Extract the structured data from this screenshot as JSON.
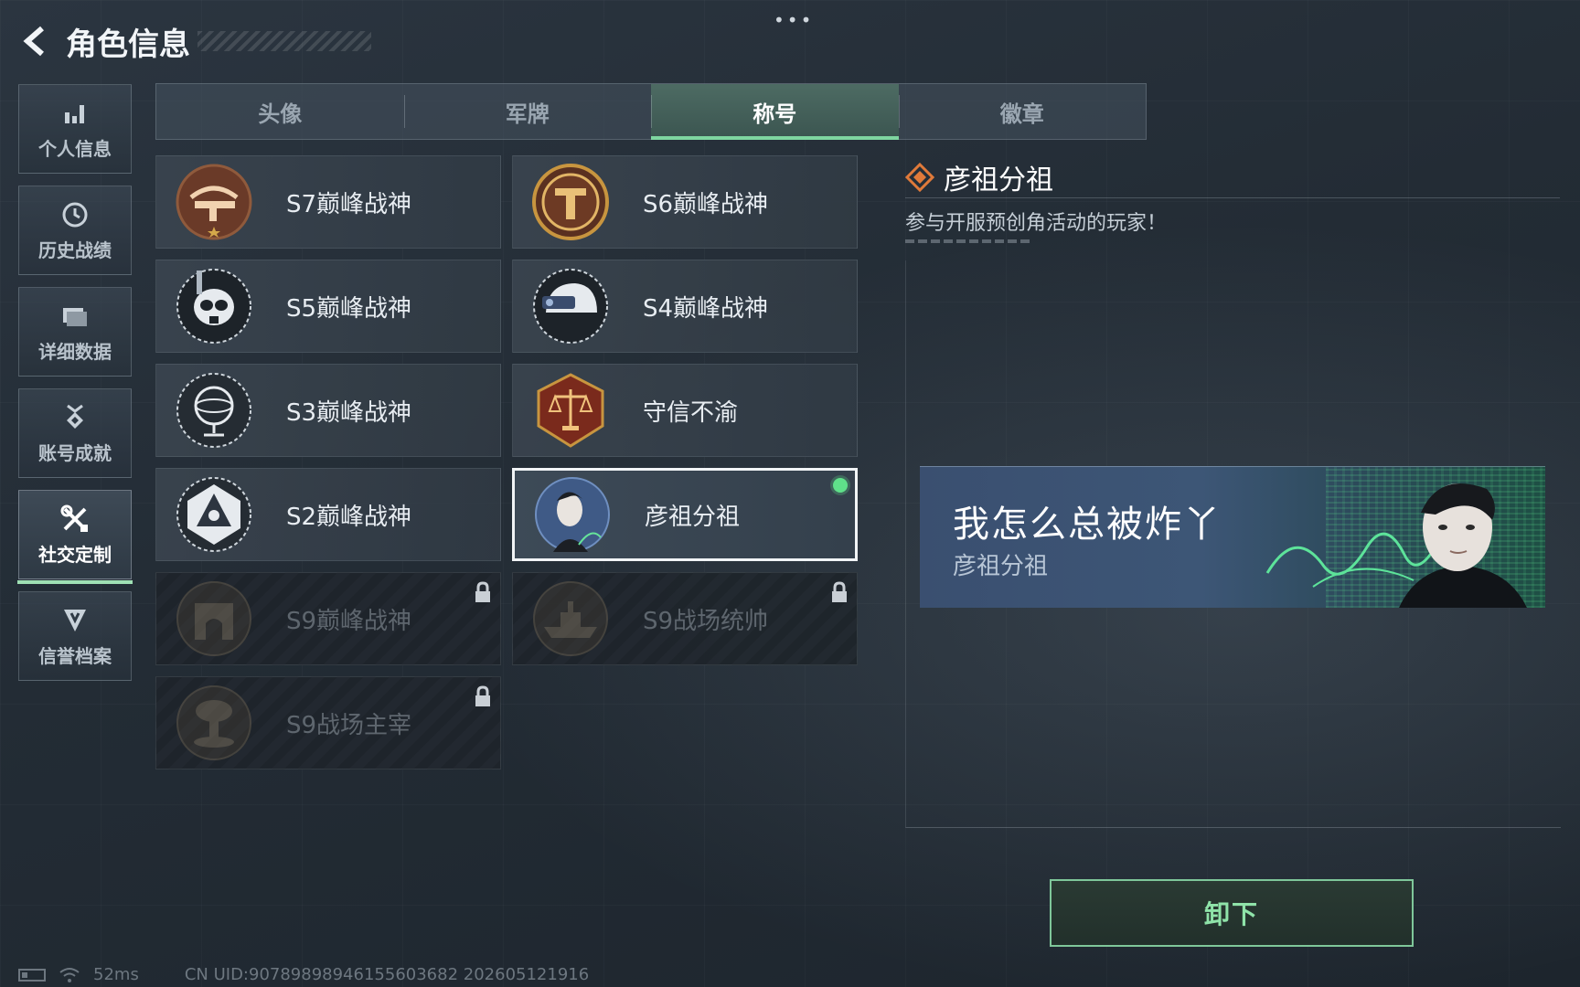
{
  "header": {
    "title": "角色信息",
    "menu_dots": "•••"
  },
  "sidebar": {
    "items": [
      {
        "label": "个人信息",
        "icon": "bar-chart-icon",
        "active": false
      },
      {
        "label": "历史战绩",
        "icon": "clock-icon",
        "active": false
      },
      {
        "label": "详细数据",
        "icon": "folder-icon",
        "active": false
      },
      {
        "label": "账号成就",
        "icon": "medal-icon",
        "active": false
      },
      {
        "label": "社交定制",
        "icon": "tools-icon",
        "active": true
      },
      {
        "label": "信誉档案",
        "icon": "shield-badge-icon",
        "active": false
      }
    ]
  },
  "tabs": [
    {
      "label": "头像",
      "active": false
    },
    {
      "label": "军牌",
      "active": false
    },
    {
      "label": "称号",
      "active": true
    },
    {
      "label": "徽章",
      "active": false
    }
  ],
  "titles": [
    {
      "label": "S7巅峰战神",
      "icon": "crossbow-emblem-icon",
      "state": "unlocked"
    },
    {
      "label": "S6巅峰战神",
      "icon": "t-shield-emblem-icon",
      "state": "unlocked"
    },
    {
      "label": "S5巅峰战神",
      "icon": "skull-diver-emblem-icon",
      "state": "unlocked"
    },
    {
      "label": "S4巅峰战神",
      "icon": "helmet-emblem-icon",
      "state": "unlocked"
    },
    {
      "label": "S3巅峰战神",
      "icon": "globe-emblem-icon",
      "state": "unlocked"
    },
    {
      "label": "守信不渝",
      "icon": "scales-emblem-icon",
      "state": "unlocked"
    },
    {
      "label": "S2巅峰战神",
      "icon": "triangle-emblem-icon",
      "state": "unlocked"
    },
    {
      "label": "彦祖分祖",
      "icon": "portrait-emblem-icon",
      "state": "equipped"
    },
    {
      "label": "S9巅峰战神",
      "icon": "building-emblem-icon",
      "state": "locked"
    },
    {
      "label": "S9战场统帅",
      "icon": "warship-emblem-icon",
      "state": "locked"
    },
    {
      "label": "S9战场主宰",
      "icon": "explosion-emblem-icon",
      "state": "locked"
    }
  ],
  "detail": {
    "title": "彦祖分祖",
    "description": "参与开服预创角活动的玩家！",
    "banner_main": "我怎么总被炸丫",
    "banner_sub": "彦祖分祖",
    "action_label": "卸下"
  },
  "status": {
    "ping": "52ms",
    "uid": "CN UID:9078989894615560368​2 202605121916"
  },
  "colors": {
    "accent_green": "#7ed6a0",
    "equipped_dot": "#5fe08a",
    "detail_icon": "#e07a3a"
  }
}
